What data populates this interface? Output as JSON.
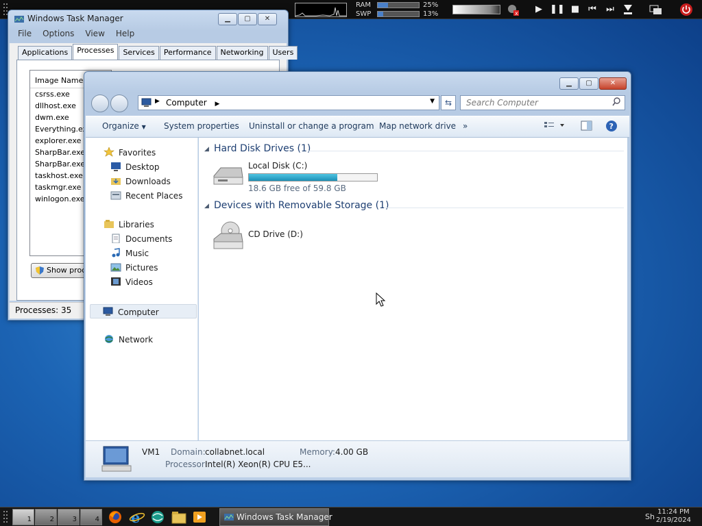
{
  "topbar": {
    "ram_label": "RAM",
    "swp_label": "SWP",
    "ram_percent": "25%",
    "swp_percent": "13%",
    "ram_fraction": 0.25,
    "swp_fraction": 0.13
  },
  "taskmgr": {
    "title": "Windows Task Manager",
    "menu": [
      "File",
      "Options",
      "View",
      "Help"
    ],
    "tabs": [
      "Applications",
      "Processes",
      "Services",
      "Performance",
      "Networking",
      "Users"
    ],
    "active_tab": "Processes",
    "column_header": "Image Name",
    "processes": [
      "csrss.exe",
      "dllhost.exe",
      "dwm.exe",
      "Everything.exe",
      "explorer.exe",
      "SharpBar.exe...",
      "SharpBar.exe...",
      "taskhost.exe",
      "taskmgr.exe",
      "winlogon.exe"
    ],
    "show_button": "Show proce",
    "status": "Processes: 35"
  },
  "explorer": {
    "address": "Computer",
    "search_placeholder": "Search Computer",
    "commands": {
      "organize": "Organize",
      "system_properties": "System properties",
      "uninstall": "Uninstall or change a program",
      "map_drive": "Map network drive",
      "more": "»"
    },
    "nav": {
      "favorites": "Favorites",
      "desktop": "Desktop",
      "downloads": "Downloads",
      "recent": "Recent Places",
      "libraries": "Libraries",
      "documents": "Documents",
      "music": "Music",
      "pictures": "Pictures",
      "videos": "Videos",
      "computer": "Computer",
      "network": "Network"
    },
    "groups": {
      "hdd": "Hard Disk Drives (1)",
      "removable": "Devices with Removable Storage (1)"
    },
    "drives": {
      "c_name": "Local Disk (C:)",
      "c_free": "18.6 GB free of 59.8 GB",
      "c_used_fraction": 0.689,
      "d_name": "CD Drive (D:)"
    },
    "details": {
      "name": "VM1",
      "domain_label": "Domain:",
      "domain": "collabnet.local",
      "memory_label": "Memory:",
      "memory": "4.00 GB",
      "processor_label": "Processor:",
      "processor": "Intel(R) Xeon(R) CPU E5..."
    }
  },
  "taskbar": {
    "workspaces": [
      "1",
      "2",
      "3",
      "4"
    ],
    "task_label": "Windows Task Manager",
    "tray_text": "Sh",
    "time": "11:24 PM",
    "date": "2/19/2024"
  }
}
